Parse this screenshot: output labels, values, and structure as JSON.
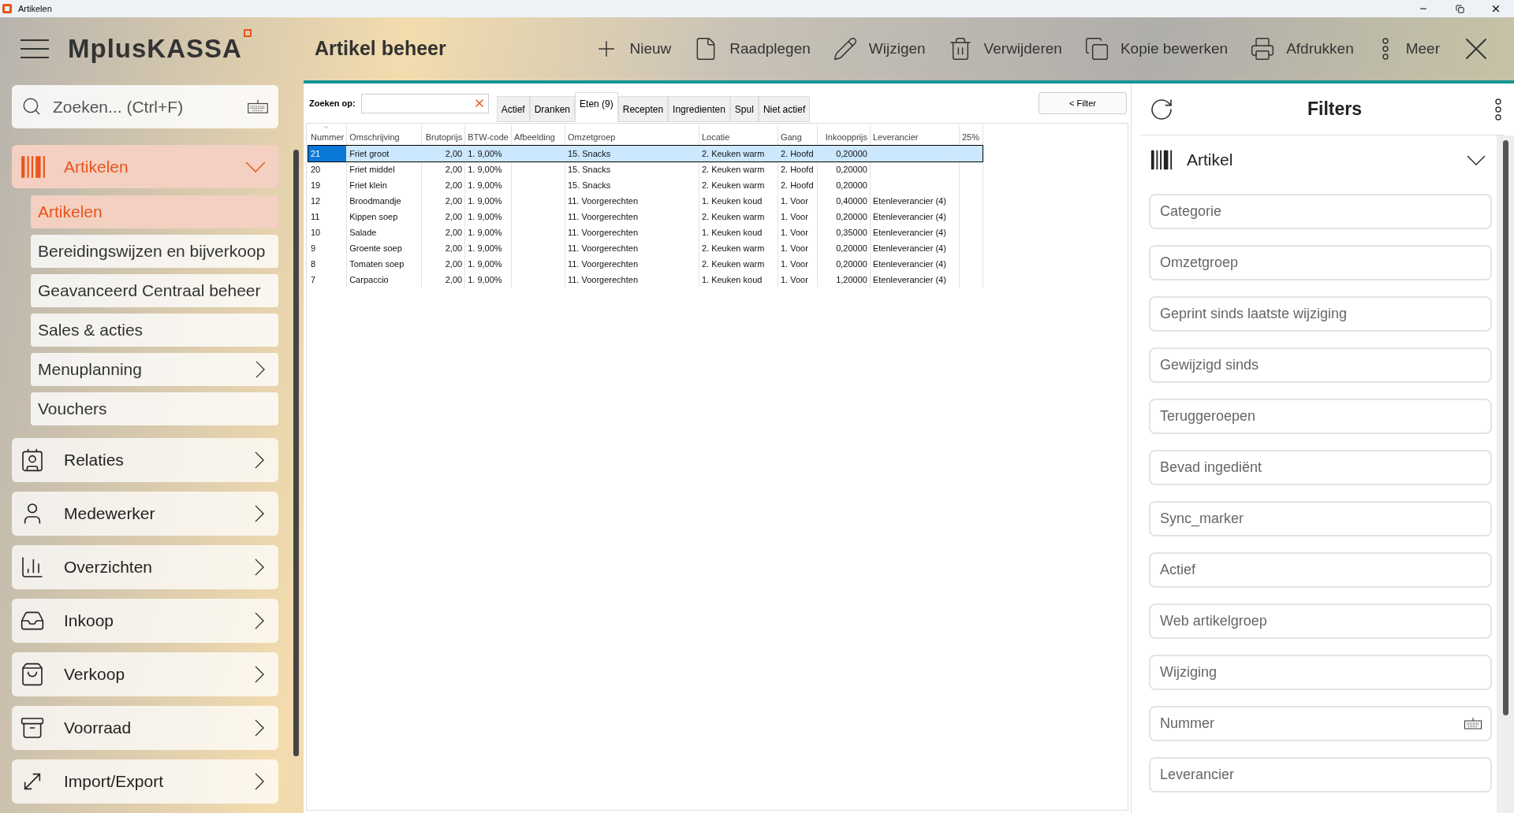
{
  "window": {
    "title": "Artikelen"
  },
  "header": {
    "logo": "MplusKASSA",
    "page_title": "Artikel beheer"
  },
  "toolbar": [
    {
      "kind": "new",
      "label": "Nieuw"
    },
    {
      "kind": "view",
      "label": "Raadplegen"
    },
    {
      "kind": "edit",
      "label": "Wijzigen"
    },
    {
      "kind": "delete",
      "label": "Verwijderen"
    },
    {
      "kind": "copy",
      "label": "Kopie bewerken"
    },
    {
      "kind": "print",
      "label": "Afdrukken"
    },
    {
      "kind": "more",
      "label": "Meer"
    }
  ],
  "sidebar": {
    "search": {
      "placeholder": "Zoeken... (Ctrl+F)"
    },
    "items": [
      {
        "kind": "barcode",
        "label": "Artikelen",
        "expanded": true,
        "children": [
          {
            "label": "Artikelen",
            "selected": true,
            "submenu": false
          },
          {
            "label": "Bereidingswijzen en bijverkoop",
            "selected": false,
            "submenu": false
          },
          {
            "label": "Geavanceerd Centraal beheer",
            "selected": false,
            "submenu": false
          },
          {
            "label": "Sales & acties",
            "selected": false,
            "submenu": false
          },
          {
            "label": "Menuplanning",
            "selected": false,
            "submenu": true
          },
          {
            "label": "Vouchers",
            "selected": false,
            "submenu": false
          }
        ]
      },
      {
        "kind": "contacts",
        "label": "Relaties",
        "expanded": false
      },
      {
        "kind": "person",
        "label": "Medewerker",
        "expanded": false
      },
      {
        "kind": "chart",
        "label": "Overzichten",
        "expanded": false
      },
      {
        "kind": "inbox",
        "label": "Inkoop",
        "expanded": false
      },
      {
        "kind": "bag",
        "label": "Verkoop",
        "expanded": false
      },
      {
        "kind": "archive",
        "label": "Voorraad",
        "expanded": false
      },
      {
        "kind": "arrows",
        "label": "Import/Export",
        "expanded": false
      }
    ]
  },
  "search_bar": {
    "label": "Zoeken op:"
  },
  "tabs": [
    {
      "label": "Actief",
      "selected": false
    },
    {
      "label": "Dranken",
      "selected": false
    },
    {
      "label": "Eten (9)",
      "selected": true
    },
    {
      "label": "Recepten",
      "selected": false
    },
    {
      "label": "Ingredienten",
      "selected": false
    },
    {
      "label": "Spul",
      "selected": false
    },
    {
      "label": "Niet actief",
      "selected": false
    }
  ],
  "filter_button": "< Filter",
  "table": {
    "columns": [
      {
        "label": "Nummer"
      },
      {
        "label": "Omschrijving"
      },
      {
        "label": "Brutoprijs"
      },
      {
        "label": "BTW-code"
      },
      {
        "label": "Afbeelding"
      },
      {
        "label": "Omzetgroep"
      },
      {
        "label": "Locatie"
      },
      {
        "label": "Gang"
      },
      {
        "label": "Inkoopprijs"
      },
      {
        "label": "Leverancier"
      },
      {
        "label": "25%"
      }
    ],
    "rows": [
      {
        "selected": true,
        "cells": [
          "21",
          "Friet groot",
          "2,00",
          "1. 9,00%",
          "",
          "15. Snacks",
          "2. Keuken warm",
          "2. Hoofd",
          "0,20000",
          "",
          ""
        ]
      },
      {
        "selected": false,
        "cells": [
          "20",
          "Friet middel",
          "2,00",
          "1. 9,00%",
          "",
          "15. Snacks",
          "2. Keuken warm",
          "2. Hoofd",
          "0,20000",
          "",
          ""
        ]
      },
      {
        "selected": false,
        "cells": [
          "19",
          "Friet klein",
          "2,00",
          "1. 9,00%",
          "",
          "15. Snacks",
          "2. Keuken warm",
          "2. Hoofd",
          "0,20000",
          "",
          ""
        ]
      },
      {
        "selected": false,
        "cells": [
          "12",
          "Broodmandje",
          "2,00",
          "1. 9,00%",
          "",
          "11. Voorgerechten",
          "1. Keuken koud",
          "1. Voor",
          "0,40000",
          "Etenleverancier (4)",
          ""
        ]
      },
      {
        "selected": false,
        "cells": [
          "11",
          "Kippen soep",
          "2,00",
          "1. 9,00%",
          "",
          "11. Voorgerechten",
          "2. Keuken warm",
          "1. Voor",
          "0,20000",
          "Etenleverancier (4)",
          ""
        ]
      },
      {
        "selected": false,
        "cells": [
          "10",
          "Salade",
          "2,00",
          "1. 9,00%",
          "",
          "11. Voorgerechten",
          "1. Keuken koud",
          "1. Voor",
          "0,35000",
          "Etenleverancier (4)",
          ""
        ]
      },
      {
        "selected": false,
        "cells": [
          "9",
          "Groente soep",
          "2,00",
          "1. 9,00%",
          "",
          "11. Voorgerechten",
          "2. Keuken warm",
          "1. Voor",
          "0,20000",
          "Etenleverancier (4)",
          ""
        ]
      },
      {
        "selected": false,
        "cells": [
          "8",
          "Tomaten soep",
          "2,00",
          "1. 9,00%",
          "",
          "11. Voorgerechten",
          "2. Keuken warm",
          "1. Voor",
          "0,20000",
          "Etenleverancier (4)",
          ""
        ]
      },
      {
        "selected": false,
        "cells": [
          "7",
          "Carpaccio",
          "2,00",
          "1. 9,00%",
          "",
          "11. Voorgerechten",
          "1. Keuken koud",
          "1. Voor",
          "1,20000",
          "Etenleverancier (4)",
          ""
        ]
      }
    ]
  },
  "filters": {
    "title": "Filters",
    "section": {
      "label": "Artikel",
      "expanded": true
    },
    "fields": [
      {
        "placeholder": "Categorie",
        "keyboard": false
      },
      {
        "placeholder": "Omzetgroep",
        "keyboard": false
      },
      {
        "placeholder": "Geprint sinds laatste wijziging",
        "keyboard": false
      },
      {
        "placeholder": "Gewijzigd sinds",
        "keyboard": false
      },
      {
        "placeholder": "Teruggeroepen",
        "keyboard": false
      },
      {
        "placeholder": "Bevad ingediënt",
        "keyboard": false
      },
      {
        "placeholder": "Sync_marker",
        "keyboard": false
      },
      {
        "placeholder": "Actief",
        "keyboard": false
      },
      {
        "placeholder": "Web artikelgroep",
        "keyboard": false
      },
      {
        "placeholder": "Wijziging",
        "keyboard": false
      },
      {
        "placeholder": "Nummer",
        "keyboard": true
      },
      {
        "placeholder": "Leverancier",
        "keyboard": false
      }
    ]
  }
}
